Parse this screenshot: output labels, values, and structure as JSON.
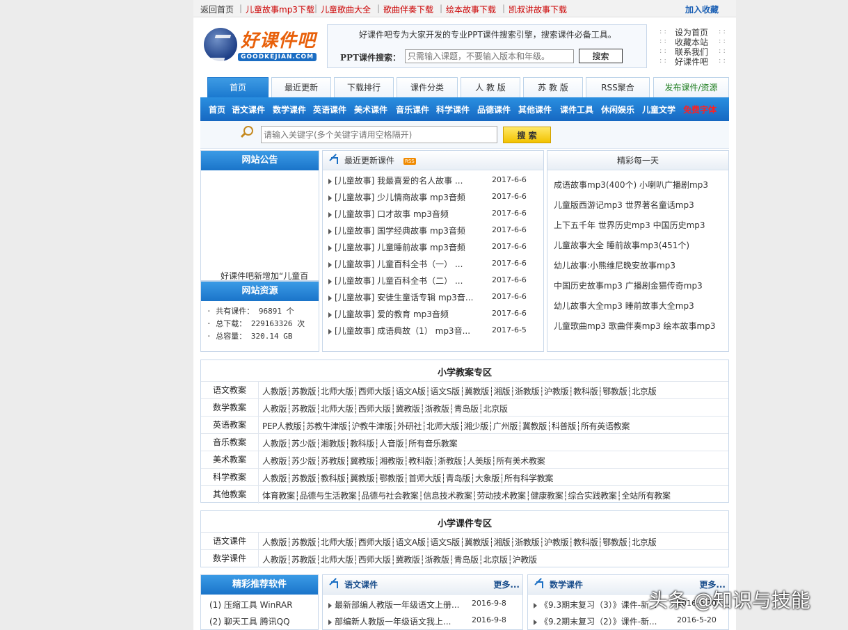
{
  "topbar": {
    "home": "返回首页",
    "links": [
      "儿童故事mp3下载",
      "儿童歌曲大全",
      "歌曲伴奏下载",
      "绘本故事下载",
      "凯叔讲故事下载"
    ],
    "favorite": "加入收藏"
  },
  "logo": {
    "title": "好课件吧",
    "sub": "GOODKEJIAN.COM"
  },
  "header_search": {
    "intro": "好课件吧专为大家开发的专业PPT课件搜索引擎，搜索课件必备工具。",
    "label": "PPT课件搜索：",
    "placeholder": "只需输入课题，不要输入版本和年级。",
    "button": "搜索"
  },
  "quick_links": [
    "设为首页",
    "收藏本站",
    "联系我们",
    "好课件吧"
  ],
  "tabs": [
    "首页",
    "最近更新",
    "下载排行",
    "课件分类",
    "人 教 版",
    "苏 教 版",
    "RSS聚合",
    "发布课件/资源"
  ],
  "categories": [
    "首页",
    "语文课件",
    "数学课件",
    "英语课件",
    "美术课件",
    "音乐课件",
    "科学课件",
    "品德课件",
    "其他课件",
    "课件工具",
    "休闲娱乐",
    "儿童文学",
    "免费字体"
  ],
  "keyword_search": {
    "placeholder": "请输入关键字(多个关键字请用空格隔开)",
    "button": "搜 索"
  },
  "notice": {
    "title": "网站公告",
    "scroll_text": "好课件吧新增加“儿童百"
  },
  "resources": {
    "title": "网站资源",
    "items": [
      "· 共有课件： 96891 个",
      "· 总下载： 229163326 次",
      "· 总容量： 320.14 GB"
    ]
  },
  "recent": {
    "title": "最近更新课件",
    "rss": "RSS",
    "items": [
      {
        "text": "[儿童故事] 我最喜爱的名人故事 ...",
        "date": "2017-6-6"
      },
      {
        "text": "[儿童故事] 少儿情商故事 mp3音频",
        "date": "2017-6-6"
      },
      {
        "text": "[儿童故事] 口才故事 mp3音频",
        "date": "2017-6-6"
      },
      {
        "text": "[儿童故事] 国学经典故事 mp3音频",
        "date": "2017-6-6"
      },
      {
        "text": "[儿童故事] 儿童睡前故事 mp3音频",
        "date": "2017-6-6"
      },
      {
        "text": "[儿童故事] 儿童百科全书（一） ...",
        "date": "2017-6-6"
      },
      {
        "text": "[儿童故事] 儿童百科全书（二） ...",
        "date": "2017-6-6"
      },
      {
        "text": "[儿童故事] 安徒生童话专辑 mp3音...",
        "date": "2017-6-6"
      },
      {
        "text": "[儿童故事] 爱的教育 mp3音频",
        "date": "2017-6-6"
      },
      {
        "text": "[儿童故事] 成语典故（1） mp3音...",
        "date": "2017-6-5"
      }
    ]
  },
  "daily": {
    "title": "精彩每一天",
    "items": [
      "成语故事mp3(400个) 小喇叭广播剧mp3",
      "儿童版西游记mp3 世界著名童话mp3",
      "上下五千年 世界历史mp3 中国历史mp3",
      "儿童故事大全 睡前故事mp3(451个)",
      "幼儿故事:小熊维尼晚安故事mp3",
      "中国历史故事mp3 广播剧金猫传奇mp3",
      "幼儿故事大全mp3 睡前故事大全mp3",
      "儿童歌曲mp3 歌曲伴奏mp3 绘本故事mp3"
    ]
  },
  "lesson_plans": {
    "title": "小学教案专区",
    "rows": [
      {
        "cat": "语文教案",
        "links": "人教版┆苏教版┆北师大版┆西师大版┆语文A版┆语文S版┆冀教版┆湘版┆浙教版┆沪教版┆教科版┆鄂教版┆北京版"
      },
      {
        "cat": "数学教案",
        "links": "人教版┆苏教版┆北师大版┆西师大版┆冀教版┆浙教版┆青岛版┆北京版"
      },
      {
        "cat": "英语教案",
        "links": "PEP人教版┆苏教牛津版┆沪教牛津版┆外研社┆北师大版┆湘少版┆广州版┆冀教版┆科普版┆所有英语教案"
      },
      {
        "cat": "音乐教案",
        "links": "人教版┆苏少版┆湘教版┆教科版┆人音版┆所有音乐教案"
      },
      {
        "cat": "美术教案",
        "links": "人教版┆苏少版┆苏教版┆冀教版┆湘教版┆教科版┆浙教版┆人美版┆所有美术教案"
      },
      {
        "cat": "科学教案",
        "links": "人教版┆苏教版┆教科版┆冀教版┆鄂教版┆首师大版┆青岛版┆大象版┆所有科学教案"
      },
      {
        "cat": "其他教案",
        "links": "体育教案┆品德与生活教案┆品德与社会教案┆信息技术教案┆劳动技术教案┆健康教案┆综合实践教案┆全站所有教案"
      }
    ]
  },
  "courseware": {
    "title": "小学课件专区",
    "rows": [
      {
        "cat": "语文课件",
        "links": "人教版┆苏教版┆北师大版┆西师大版┆语文A版┆语文S版┆冀教版┆湘版┆浙教版┆沪教版┆教科版┆鄂教版┆北京版"
      },
      {
        "cat": "数学课件",
        "links": "人教版┆苏教版┆北师大版┆西师大版┆冀教版┆浙教版┆青岛版┆北京版┆沪教版"
      }
    ]
  },
  "software": {
    "title": "精彩推荐软件",
    "items": [
      "(1) 压缩工具 WinRAR",
      "(2) 聊天工具 腾讯QQ"
    ]
  },
  "chinese_box": {
    "title": "语文课件",
    "more": "更多...",
    "items": [
      {
        "text": "最新部编人教版一年级语文上册...",
        "date": "2016-9-8"
      },
      {
        "text": "部编新人教版一年级语文我上...",
        "date": "2016-9-8"
      }
    ]
  },
  "math_box": {
    "title": "数学课件",
    "more": "更多...",
    "items": [
      {
        "text": "《9.3期末复习（3）》课件-新...",
        "date": "2016-5-20"
      },
      {
        "text": "《9.2期末复习（2）》课件-新...",
        "date": "2016-5-20"
      }
    ]
  },
  "watermark": "头条 @知识与技能",
  "colors": {
    "accent": "#1a74c9",
    "topbar_link": "#cc0000",
    "logo_orange": "#e8600a"
  }
}
